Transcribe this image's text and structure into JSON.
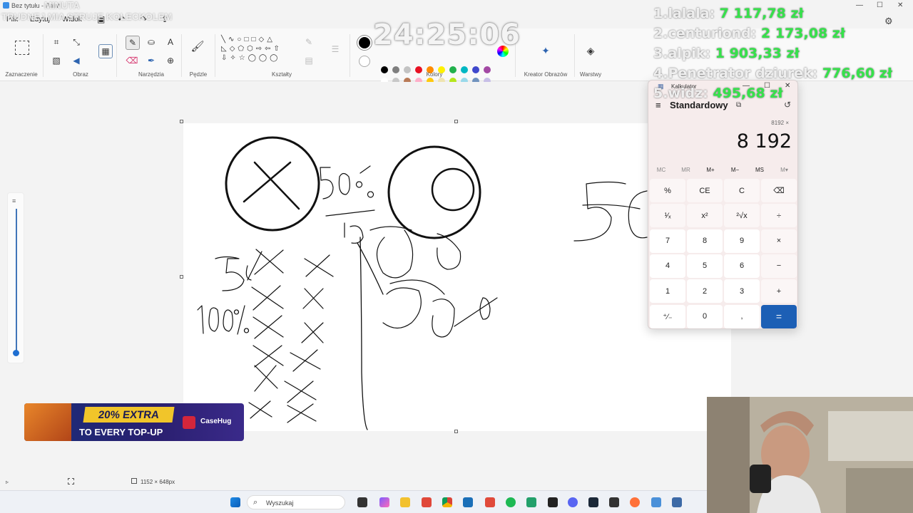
{
  "window": {
    "title": "Bez tytułu - Paint"
  },
  "menu": {
    "file": "Plik",
    "edit": "Edytuj",
    "view": "Widok"
  },
  "ribbon": {
    "groups": {
      "selection": "Zaznaczenie",
      "image": "Obraz",
      "tools": "Narzędzia",
      "brushes": "Pędzle",
      "shapes": "Kształty",
      "colors": "Kolory",
      "image_creator": "Kreator Obrazów",
      "layers": "Warstwy"
    },
    "palette_row1": [
      "#000000",
      "#7f7f7f",
      "#c3c3c3",
      "#e81123",
      "#ff8c00",
      "#fff100",
      "#22b14c",
      "#00b7c3",
      "#3f48cc",
      "#a349a4"
    ],
    "palette_row2": [
      "#ffffff",
      "#c8c8c8",
      "#b97a57",
      "#ffaec9",
      "#ffc90e",
      "#efe4b0",
      "#b5e61d",
      "#99d9ea",
      "#7092be",
      "#c8bfe7"
    ]
  },
  "status": {
    "canvas_size": "1152 × 648px"
  },
  "overlay": {
    "top_line1": "MINUTA",
    "top_line2": "TRUDNEJ MIA STRUJE KOŁECKOLEM",
    "timer": "24:25:06",
    "leaderboard": [
      {
        "name": "1.lalala:",
        "value": "7 117,78 zł"
      },
      {
        "name": "2.centuriond:",
        "value": "2 173,08 zł"
      },
      {
        "name": "3.alpik:",
        "value": "1 903,33 zł"
      },
      {
        "name": "4.Penetrator dziurek:",
        "value": "776,60 zł"
      },
      {
        "name": "5.widz:",
        "value": "495,68 zł"
      }
    ]
  },
  "calculator": {
    "app_title": "Kalkulator",
    "mode": "Standardowy",
    "expression": "8192 ×",
    "display": "8 192",
    "memory": [
      "MC",
      "MR",
      "M+",
      "M−",
      "MS",
      "M▾"
    ],
    "keys": [
      [
        "%",
        "CE",
        "C",
        "⌫"
      ],
      [
        "¹⁄ₓ",
        "x²",
        "²√x",
        "÷"
      ],
      [
        "7",
        "8",
        "9",
        "×"
      ],
      [
        "4",
        "5",
        "6",
        "−"
      ],
      [
        "1",
        "2",
        "3",
        "+"
      ],
      [
        "⁺⁄₋",
        "0",
        ",",
        "="
      ]
    ]
  },
  "promo": {
    "line1": "20% EXTRA",
    "line2": "TO EVERY TOP-UP",
    "brand": "CaseHug"
  },
  "taskbar": {
    "search_placeholder": "Wyszukaj"
  }
}
